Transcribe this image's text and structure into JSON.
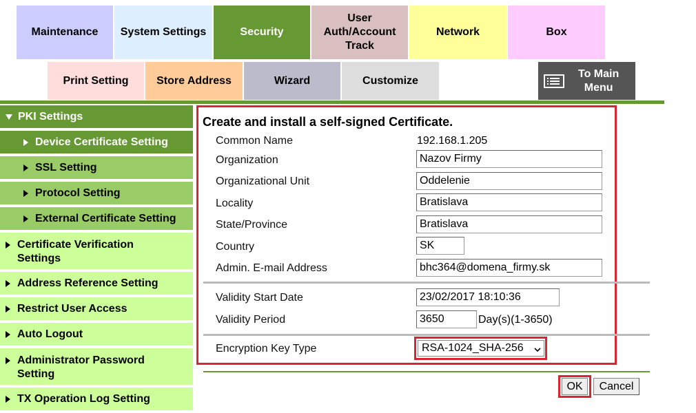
{
  "top_tabs": {
    "maintenance": "Maintenance",
    "system_settings": "System Settings",
    "security": "Security",
    "user_auth_line1": "User",
    "user_auth_line2": "Auth/Account",
    "user_auth_line3": "Track",
    "network": "Network",
    "box": "Box"
  },
  "second_tabs": {
    "print_setting": "Print Setting",
    "store_address": "Store Address",
    "wizard": "Wizard",
    "customize": "Customize",
    "to_main_line1": "To Main",
    "to_main_line2": "Menu"
  },
  "sidebar": {
    "pki_settings": "PKI Settings",
    "device_certificate_setting": "Device Certificate Setting",
    "ssl_setting": "SSL Setting",
    "protocol_setting": "Protocol Setting",
    "external_certificate_setting": "External Certificate Setting",
    "certificate_verification_line1": "Certificate Verification",
    "certificate_verification_line2": "Settings",
    "address_reference_setting": "Address Reference Setting",
    "restrict_user_access": "Restrict User Access",
    "auto_logout": "Auto Logout",
    "admin_password_line1": "Administrator Password",
    "admin_password_line2": "Setting",
    "tx_operation_log_setting": "TX Operation Log Setting"
  },
  "form": {
    "heading": "Create and install a self-signed Certificate.",
    "common_name_label": "Common Name",
    "common_name_value": "192.168.1.205",
    "organization_label": "Organization",
    "organization_value": "Nazov Firmy",
    "org_unit_label": "Organizational Unit",
    "org_unit_value": "Oddelenie",
    "locality_label": "Locality",
    "locality_value": "Bratislava",
    "state_label": "State/Province",
    "state_value": "Bratislava",
    "country_label": "Country",
    "country_value": "SK",
    "email_label": "Admin. E-mail Address",
    "email_value": "bhc364@domena_firmy.sk",
    "validity_start_label": "Validity Start Date",
    "validity_start_value": "23/02/2017 18:10:36",
    "validity_period_label": "Validity Period",
    "validity_period_value": "3650",
    "validity_period_unit": "Day(s)(1-3650)",
    "encryption_label": "Encryption Key Type",
    "encryption_value": "RSA-1024_SHA-256"
  },
  "buttons": {
    "ok": "OK",
    "cancel": "Cancel"
  },
  "colors": {
    "security_tab": "#669933",
    "sidebar_light": "#ccff99",
    "sidebar_dark": "#99cc66",
    "sidebar_header": "#669933",
    "highlight_red": "#d9252f"
  }
}
